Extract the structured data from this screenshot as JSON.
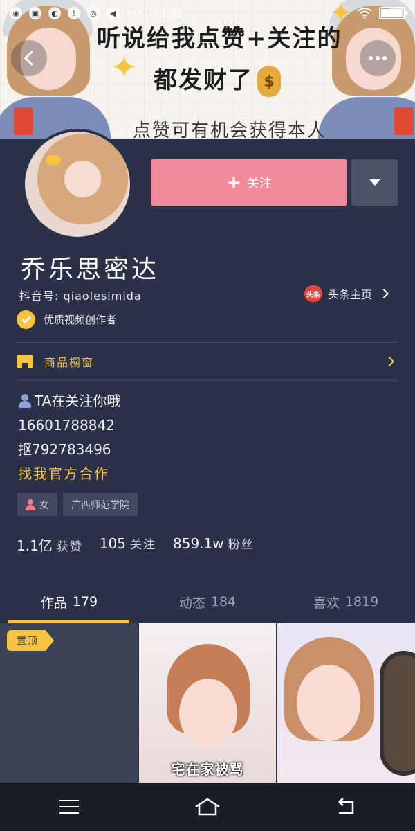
{
  "status_bar": {
    "time": "13:55",
    "battery_level_percent": 95
  },
  "banner": {
    "line1": "听说给我点赞+关注的",
    "line2": "都发财了",
    "money_symbol": "$",
    "line3": "点赞可有机会获得本人"
  },
  "profile": {
    "follow_button_label": "关注",
    "name": "乔乐思密达",
    "douyin_id": "抖音号: qiaolesimida",
    "toutiao_badge": "头条",
    "toutiao_label": "头条主页",
    "creator_label": "优质视频创作者",
    "shop_label": "商品橱窗"
  },
  "bio": {
    "line1": "TA在关注你哦",
    "line2": "16601788842",
    "line3": "抠792783496",
    "link": "找我官方合作"
  },
  "tags": {
    "gender": "女",
    "school": "广西师范学院"
  },
  "stats": {
    "likes_value": "1.1亿",
    "likes_label": "获赞",
    "following_value": "105",
    "following_label": "关注",
    "followers_value": "859.1w",
    "followers_label": "粉丝"
  },
  "tabs": [
    {
      "label": "作品",
      "count": "179"
    },
    {
      "label": "动态",
      "count": "184"
    },
    {
      "label": "喜欢",
      "count": "1819"
    }
  ],
  "videos": {
    "pin_label": "置顶",
    "caption_2": "宅在家被骂"
  },
  "colors": {
    "background": "#2b3148",
    "accent_yellow": "#f5c542",
    "follow_pink": "#f08b9b"
  }
}
